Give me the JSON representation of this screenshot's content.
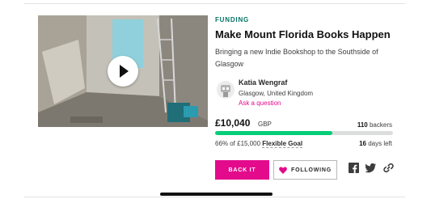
{
  "project": {
    "category": "FUNDING",
    "title": "Make Mount Florida Books Happen",
    "blurb": "Bringing a new Indie Bookshop to the Southside of Glasgow"
  },
  "creator": {
    "name": "Katia Wengraf",
    "location": "Glasgow, United Kingdom",
    "ask_link": "Ask a question"
  },
  "stats": {
    "pledged": "£10,040",
    "currency": "GBP",
    "backers_count": "110",
    "backers_label": "backers",
    "percent_funded": 66,
    "percent_text": "66% of £15,000",
    "goal_type": "Flexible Goal",
    "days_count": "16",
    "days_label": "days left"
  },
  "actions": {
    "back_it": "BACK IT",
    "following": "FOLLOWING"
  },
  "icons": {
    "play": "play-icon",
    "heart": "heart-icon",
    "facebook": "facebook-icon",
    "twitter": "twitter-icon",
    "link": "link-icon"
  },
  "colors": {
    "accent": "#e30b8c",
    "progress": "#05ce78",
    "category": "#037362"
  }
}
